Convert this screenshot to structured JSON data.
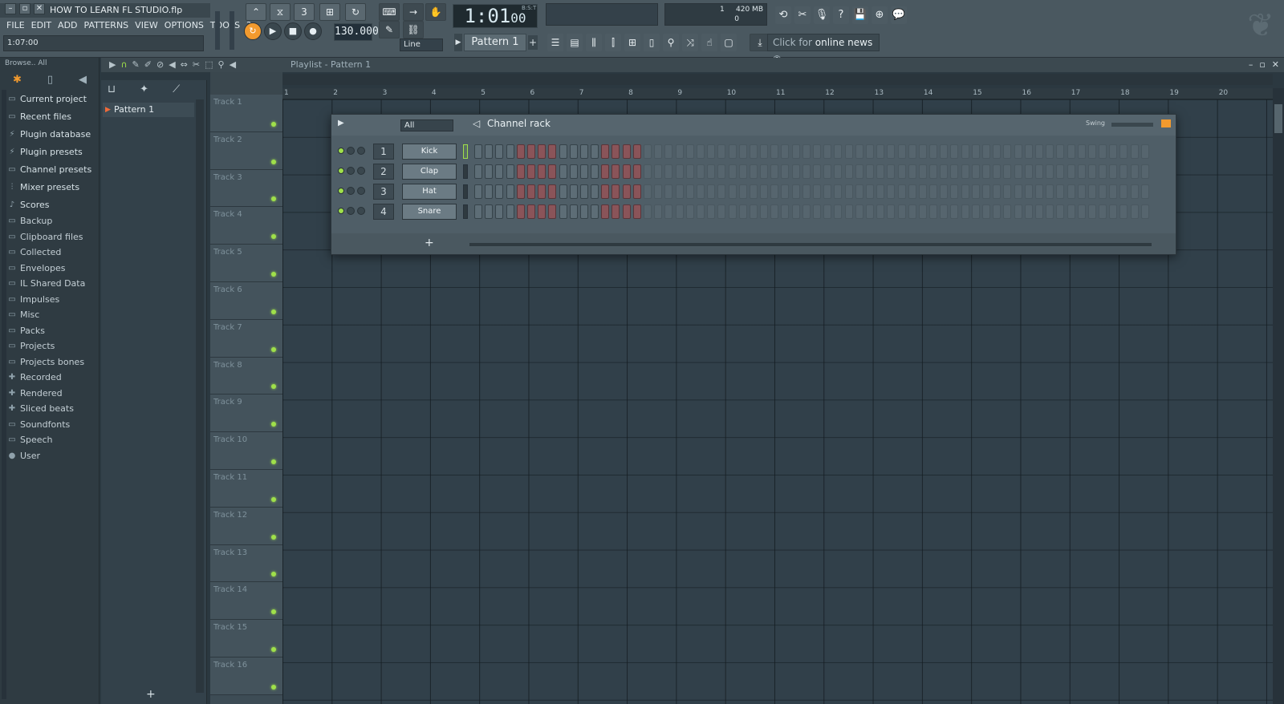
{
  "window": {
    "title": "HOW TO LEARN FL STUDIO.flp",
    "buttons": [
      "–",
      "▫",
      "✕"
    ]
  },
  "menu": [
    "FILE",
    "EDIT",
    "ADD",
    "PATTERNS",
    "VIEW",
    "OPTIONS",
    "TOOLS",
    "?"
  ],
  "hint_bar": "1:07:00",
  "transport": {
    "song_position": "1:01",
    "song_position_sub": "00",
    "tempo": "130.000",
    "pattern": "Pattern 1",
    "snap": "Line",
    "bst": "B:S:T"
  },
  "cpu": {
    "memory": "420 MB",
    "voices": "1",
    "voices2": "0"
  },
  "news": {
    "prefix": "Click for",
    "link": "online news"
  },
  "browser": {
    "toolbar": "Browse.. All",
    "items": [
      {
        "label": "Current project",
        "icon": "folder-icon"
      },
      {
        "label": "Recent files",
        "icon": "folder-icon"
      },
      {
        "label": "Plugin database",
        "icon": "plug-icon"
      },
      {
        "label": "Plugin presets",
        "icon": "plug-icon"
      },
      {
        "label": "Channel presets",
        "icon": "folder-icon"
      },
      {
        "label": "Mixer presets",
        "icon": "mixer-icon"
      },
      {
        "label": "Scores",
        "icon": "note-icon"
      },
      {
        "label": "Backup",
        "icon": "folder-icon"
      },
      {
        "label": "Clipboard files",
        "icon": "folder-icon"
      },
      {
        "label": "Collected",
        "icon": "folder-icon"
      },
      {
        "label": "Envelopes",
        "icon": "folder-icon"
      },
      {
        "label": "IL Shared Data",
        "icon": "folder-icon"
      },
      {
        "label": "Impulses",
        "icon": "folder-icon"
      },
      {
        "label": "Misc",
        "icon": "folder-icon"
      },
      {
        "label": "Packs",
        "icon": "folder-icon"
      },
      {
        "label": "Projects",
        "icon": "folder-icon"
      },
      {
        "label": "Projects bones",
        "icon": "folder-icon"
      },
      {
        "label": "Recorded",
        "icon": "plus-icon"
      },
      {
        "label": "Rendered",
        "icon": "plus-icon"
      },
      {
        "label": "Sliced beats",
        "icon": "plus-icon"
      },
      {
        "label": "Soundfonts",
        "icon": "folder-icon"
      },
      {
        "label": "Speech",
        "icon": "folder-icon"
      },
      {
        "label": "User",
        "icon": "user-icon"
      }
    ]
  },
  "picker": {
    "pattern": "Pattern 1",
    "add": "+"
  },
  "playlist": {
    "title": "Playlist - Pattern 1",
    "ruler": [
      "1",
      "2",
      "3",
      "4",
      "5",
      "6",
      "7",
      "8",
      "9",
      "10",
      "11",
      "12",
      "13",
      "14",
      "15",
      "16",
      "17",
      "18",
      "19",
      "20"
    ],
    "tracks": [
      "Track 1",
      "Track 2",
      "Track 3",
      "Track 4",
      "Track 5",
      "Track 6",
      "Track 7",
      "Track 8",
      "Track 9",
      "Track 10",
      "Track 11",
      "Track 12",
      "Track 13",
      "Track 14",
      "Track 15",
      "Track 16"
    ]
  },
  "channel_rack": {
    "title": "Channel rack",
    "filter": "All",
    "swing_label": "Swing",
    "add": "+",
    "channels": [
      {
        "num": "1",
        "name": "Kick"
      },
      {
        "num": "2",
        "name": "Clap"
      },
      {
        "num": "3",
        "name": "Hat"
      },
      {
        "num": "4",
        "name": "Snare"
      }
    ]
  },
  "colors": {
    "accent": "#f29a2e",
    "led": "#9fe04a",
    "step_red": "#8a5459"
  }
}
